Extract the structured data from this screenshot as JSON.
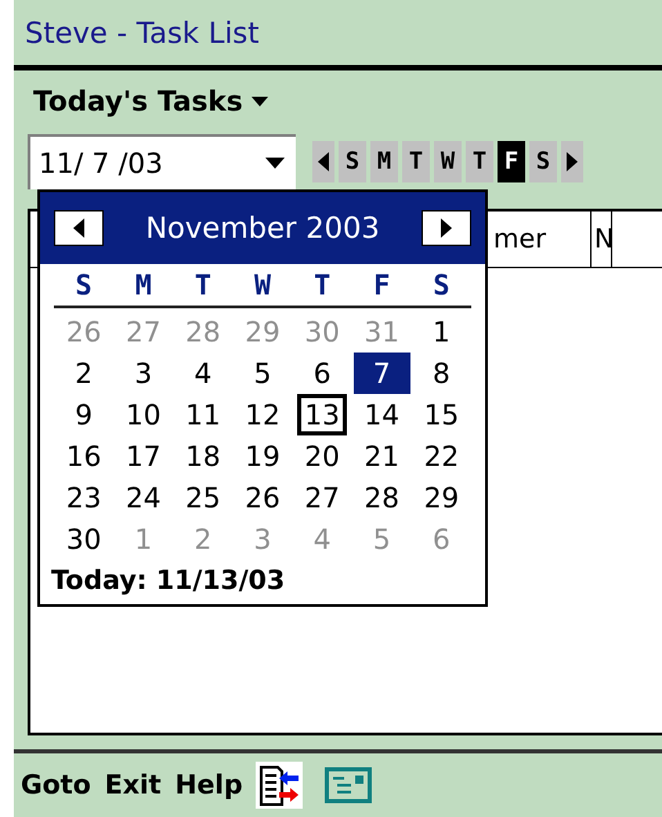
{
  "window": {
    "title": "Steve - Task List"
  },
  "view_menu": {
    "label": "Today's Tasks"
  },
  "date_field": {
    "value": "11/ 7 /03"
  },
  "day_strip": [
    {
      "label": "S",
      "selected": false
    },
    {
      "label": "M",
      "selected": false
    },
    {
      "label": "T",
      "selected": false
    },
    {
      "label": "W",
      "selected": false
    },
    {
      "label": "T",
      "selected": false
    },
    {
      "label": "F",
      "selected": true
    },
    {
      "label": "S",
      "selected": false
    }
  ],
  "table": {
    "columns": [
      {
        "label": "mer"
      },
      {
        "label": "N"
      }
    ]
  },
  "calendar": {
    "month": "November 2003",
    "weekdays": [
      "S",
      "M",
      "T",
      "W",
      "T",
      "F",
      "S"
    ],
    "days": [
      {
        "label": "26",
        "other_month": true,
        "selected": false,
        "today": false
      },
      {
        "label": "27",
        "other_month": true,
        "selected": false,
        "today": false
      },
      {
        "label": "28",
        "other_month": true,
        "selected": false,
        "today": false
      },
      {
        "label": "29",
        "other_month": true,
        "selected": false,
        "today": false
      },
      {
        "label": "30",
        "other_month": true,
        "selected": false,
        "today": false
      },
      {
        "label": "31",
        "other_month": true,
        "selected": false,
        "today": false
      },
      {
        "label": "1",
        "other_month": false,
        "selected": false,
        "today": false
      },
      {
        "label": "2",
        "other_month": false,
        "selected": false,
        "today": false
      },
      {
        "label": "3",
        "other_month": false,
        "selected": false,
        "today": false
      },
      {
        "label": "4",
        "other_month": false,
        "selected": false,
        "today": false
      },
      {
        "label": "5",
        "other_month": false,
        "selected": false,
        "today": false
      },
      {
        "label": "6",
        "other_month": false,
        "selected": false,
        "today": false
      },
      {
        "label": "7",
        "other_month": false,
        "selected": true,
        "today": false
      },
      {
        "label": "8",
        "other_month": false,
        "selected": false,
        "today": false
      },
      {
        "label": "9",
        "other_month": false,
        "selected": false,
        "today": false
      },
      {
        "label": "10",
        "other_month": false,
        "selected": false,
        "today": false
      },
      {
        "label": "11",
        "other_month": false,
        "selected": false,
        "today": false
      },
      {
        "label": "12",
        "other_month": false,
        "selected": false,
        "today": false
      },
      {
        "label": "13",
        "other_month": false,
        "selected": false,
        "today": true
      },
      {
        "label": "14",
        "other_month": false,
        "selected": false,
        "today": false
      },
      {
        "label": "15",
        "other_month": false,
        "selected": false,
        "today": false
      },
      {
        "label": "16",
        "other_month": false,
        "selected": false,
        "today": false
      },
      {
        "label": "17",
        "other_month": false,
        "selected": false,
        "today": false
      },
      {
        "label": "18",
        "other_month": false,
        "selected": false,
        "today": false
      },
      {
        "label": "19",
        "other_month": false,
        "selected": false,
        "today": false
      },
      {
        "label": "20",
        "other_month": false,
        "selected": false,
        "today": false
      },
      {
        "label": "21",
        "other_month": false,
        "selected": false,
        "today": false
      },
      {
        "label": "22",
        "other_month": false,
        "selected": false,
        "today": false
      },
      {
        "label": "23",
        "other_month": false,
        "selected": false,
        "today": false
      },
      {
        "label": "24",
        "other_month": false,
        "selected": false,
        "today": false
      },
      {
        "label": "25",
        "other_month": false,
        "selected": false,
        "today": false
      },
      {
        "label": "26",
        "other_month": false,
        "selected": false,
        "today": false
      },
      {
        "label": "27",
        "other_month": false,
        "selected": false,
        "today": false
      },
      {
        "label": "28",
        "other_month": false,
        "selected": false,
        "today": false
      },
      {
        "label": "29",
        "other_month": false,
        "selected": false,
        "today": false
      },
      {
        "label": "30",
        "other_month": false,
        "selected": false,
        "today": false
      },
      {
        "label": "1",
        "other_month": true,
        "selected": false,
        "today": false
      },
      {
        "label": "2",
        "other_month": true,
        "selected": false,
        "today": false
      },
      {
        "label": "3",
        "other_month": true,
        "selected": false,
        "today": false
      },
      {
        "label": "4",
        "other_month": true,
        "selected": false,
        "today": false
      },
      {
        "label": "5",
        "other_month": true,
        "selected": false,
        "today": false
      },
      {
        "label": "6",
        "other_month": true,
        "selected": false,
        "today": false
      }
    ],
    "today_label": "Today: 11/13/03"
  },
  "menu_bar": [
    {
      "label": "Goto"
    },
    {
      "label": "Exit"
    },
    {
      "label": "Help"
    }
  ]
}
